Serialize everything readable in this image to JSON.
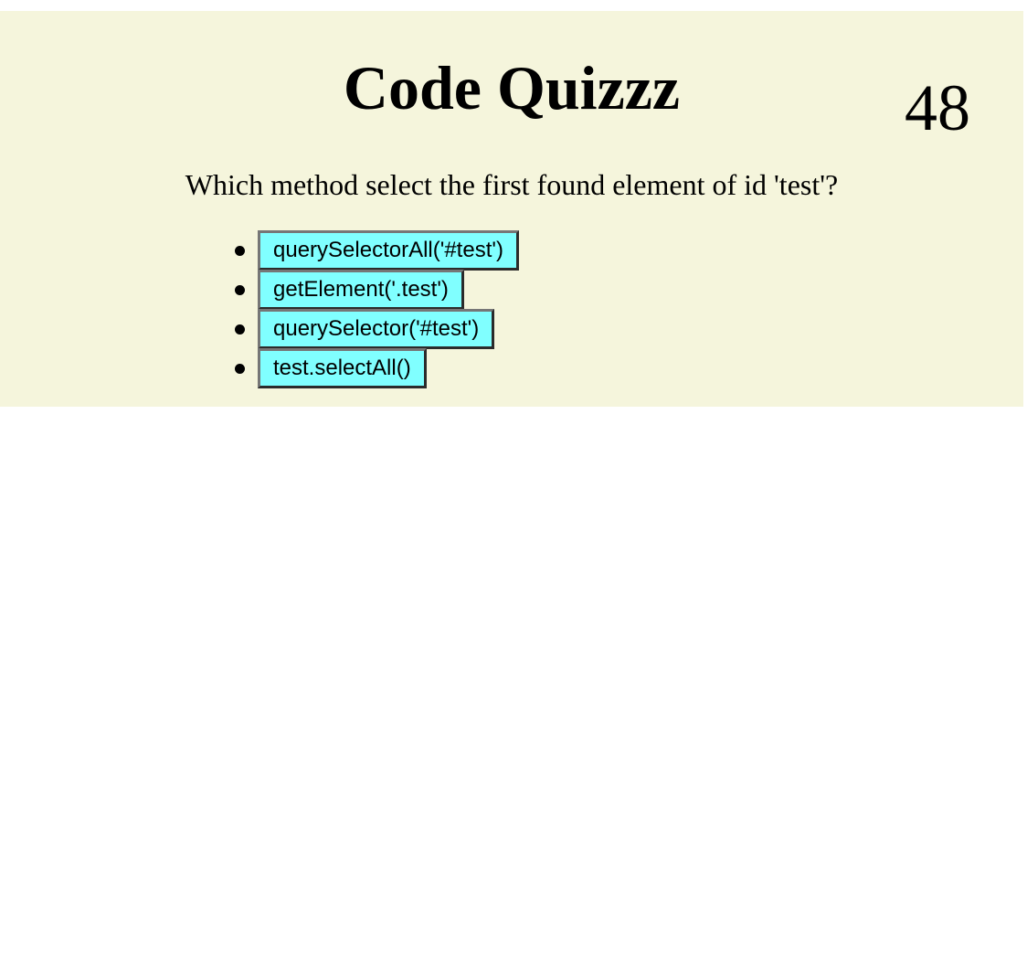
{
  "quiz": {
    "title": "Code Quizzz",
    "timer": "48",
    "question": "Which method select the first found element of id 'test'?",
    "answers": [
      "querySelectorAll('#test')",
      "getElement('.test')",
      "querySelector('#test')",
      "test.selectAll()"
    ]
  },
  "colors": {
    "panel_background": "#f5f5dc",
    "answer_button_background": "#80ffff"
  }
}
